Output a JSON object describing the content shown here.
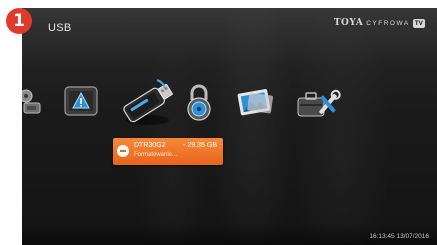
{
  "step_badge": "1",
  "header": {
    "title": "USB",
    "brand": {
      "name": "TOYA",
      "sub": "CYFROWA",
      "tv": "TV"
    }
  },
  "menu_icons": [
    {
      "name": "multimedia-icon"
    },
    {
      "name": "info-icon"
    },
    {
      "name": "usb-drive-icon"
    },
    {
      "name": "lock-icon"
    },
    {
      "name": "pictures-icon"
    },
    {
      "name": "tools-icon"
    }
  ],
  "usb_device": {
    "name": "DTR30G2",
    "size": "- 29.35 GB",
    "status": "Formatowanie..."
  },
  "footer": {
    "datetime": "16:13:45 13/07/2016"
  },
  "colors": {
    "accent": "#e8641c",
    "badge": "#e23a2a",
    "background": "#1a1a1a"
  }
}
